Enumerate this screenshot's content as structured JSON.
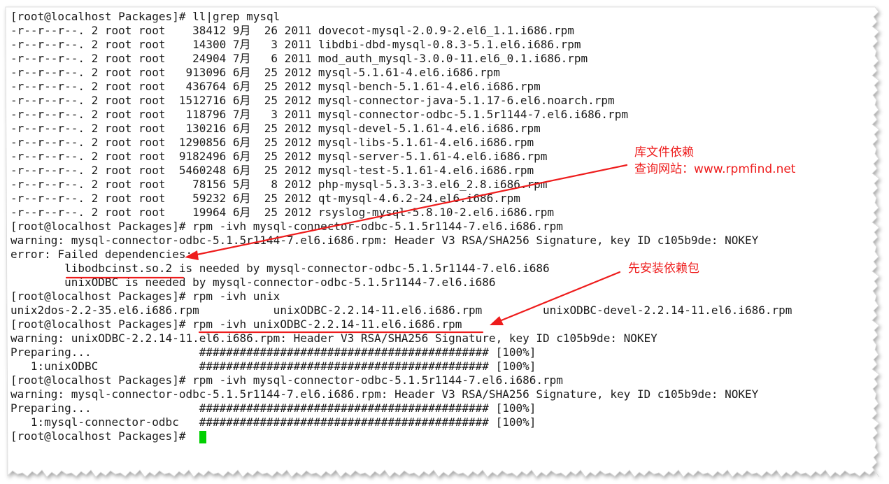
{
  "terminal": {
    "lines": [
      "[root@localhost Packages]# ll|grep mysql",
      "-r--r--r--. 2 root root    38412 9月  26 2011 dovecot-mysql-2.0.9-2.el6_1.1.i686.rpm",
      "-r--r--r--. 2 root root    14300 7月   3 2011 libdbi-dbd-mysql-0.8.3-5.1.el6.i686.rpm",
      "-r--r--r--. 2 root root    24904 7月   6 2011 mod_auth_mysql-3.0.0-11.el6_0.1.i686.rpm",
      "-r--r--r--. 2 root root   913096 6月  25 2012 mysql-5.1.61-4.el6.i686.rpm",
      "-r--r--r--. 2 root root   436764 6月  25 2012 mysql-bench-5.1.61-4.el6.i686.rpm",
      "-r--r--r--. 2 root root  1512716 6月  25 2012 mysql-connector-java-5.1.17-6.el6.noarch.rpm",
      "-r--r--r--. 2 root root   118796 7月   3 2011 mysql-connector-odbc-5.1.5r1144-7.el6.i686.rpm",
      "-r--r--r--. 2 root root   130216 6月  25 2012 mysql-devel-5.1.61-4.el6.i686.rpm",
      "-r--r--r--. 2 root root  1290856 6月  25 2012 mysql-libs-5.1.61-4.el6.i686.rpm",
      "-r--r--r--. 2 root root  9182496 6月  25 2012 mysql-server-5.1.61-4.el6.i686.rpm",
      "-r--r--r--. 2 root root  5460248 6月  25 2012 mysql-test-5.1.61-4.el6.i686.rpm",
      "-r--r--r--. 2 root root    78156 5月   8 2012 php-mysql-5.3.3-3.el6_2.8.i686.rpm",
      "-r--r--r--. 2 root root    59232 6月  25 2012 qt-mysql-4.6.2-24.el6.i686.rpm",
      "-r--r--r--. 2 root root    19964 6月  25 2012 rsyslog-mysql-5.8.10-2.el6.i686.rpm",
      "[root@localhost Packages]# rpm -ivh mysql-connector-odbc-5.1.5r1144-7.el6.i686.rpm",
      "warning: mysql-connector-odbc-5.1.5r1144-7.el6.i686.rpm: Header V3 RSA/SHA256 Signature, key ID c105b9de: NOKEY",
      "error: Failed dependencies:",
      "        libodbcinst.so.2 is needed by mysql-connector-odbc-5.1.5r1144-7.el6.i686",
      "        unixODBC is needed by mysql-connector-odbc-5.1.5r1144-7.el6.i686",
      "[root@localhost Packages]# rpm -ivh unix",
      "unix2dos-2.2-35.el6.i686.rpm           unixODBC-2.2.14-11.el6.i686.rpm         unixODBC-devel-2.2.14-11.el6.i686.rpm",
      "[root@localhost Packages]# rpm -ivh unixODBC-2.2.14-11.el6.i686.rpm",
      "warning: unixODBC-2.2.14-11.el6.i686.rpm: Header V3 RSA/SHA256 Signature, key ID c105b9de: NOKEY",
      "Preparing...                ########################################### [100%]",
      "   1:unixODBC               ########################################### [100%]",
      "[root@localhost Packages]# rpm -ivh mysql-connector-odbc-5.1.5r1144-7.el6.i686.rpm",
      "warning: mysql-connector-odbc-5.1.5r1144-7.el6.i686.rpm: Header V3 RSA/SHA256 Signature, key ID c105b9de: NOKEY",
      "Preparing...                ########################################### [100%]",
      "   1:mysql-connector-odbc   ########################################### [100%]",
      "[root@localhost Packages]# "
    ]
  },
  "annotations": {
    "lib_dependency_line1": "库文件依赖",
    "lib_dependency_line2": "查询网站：www.rpmfind.net",
    "install_first": "先安装依赖包"
  },
  "colors": {
    "annotation": "#ee1c1c",
    "cursor": "#00d000",
    "text": "#1a1a1a"
  }
}
